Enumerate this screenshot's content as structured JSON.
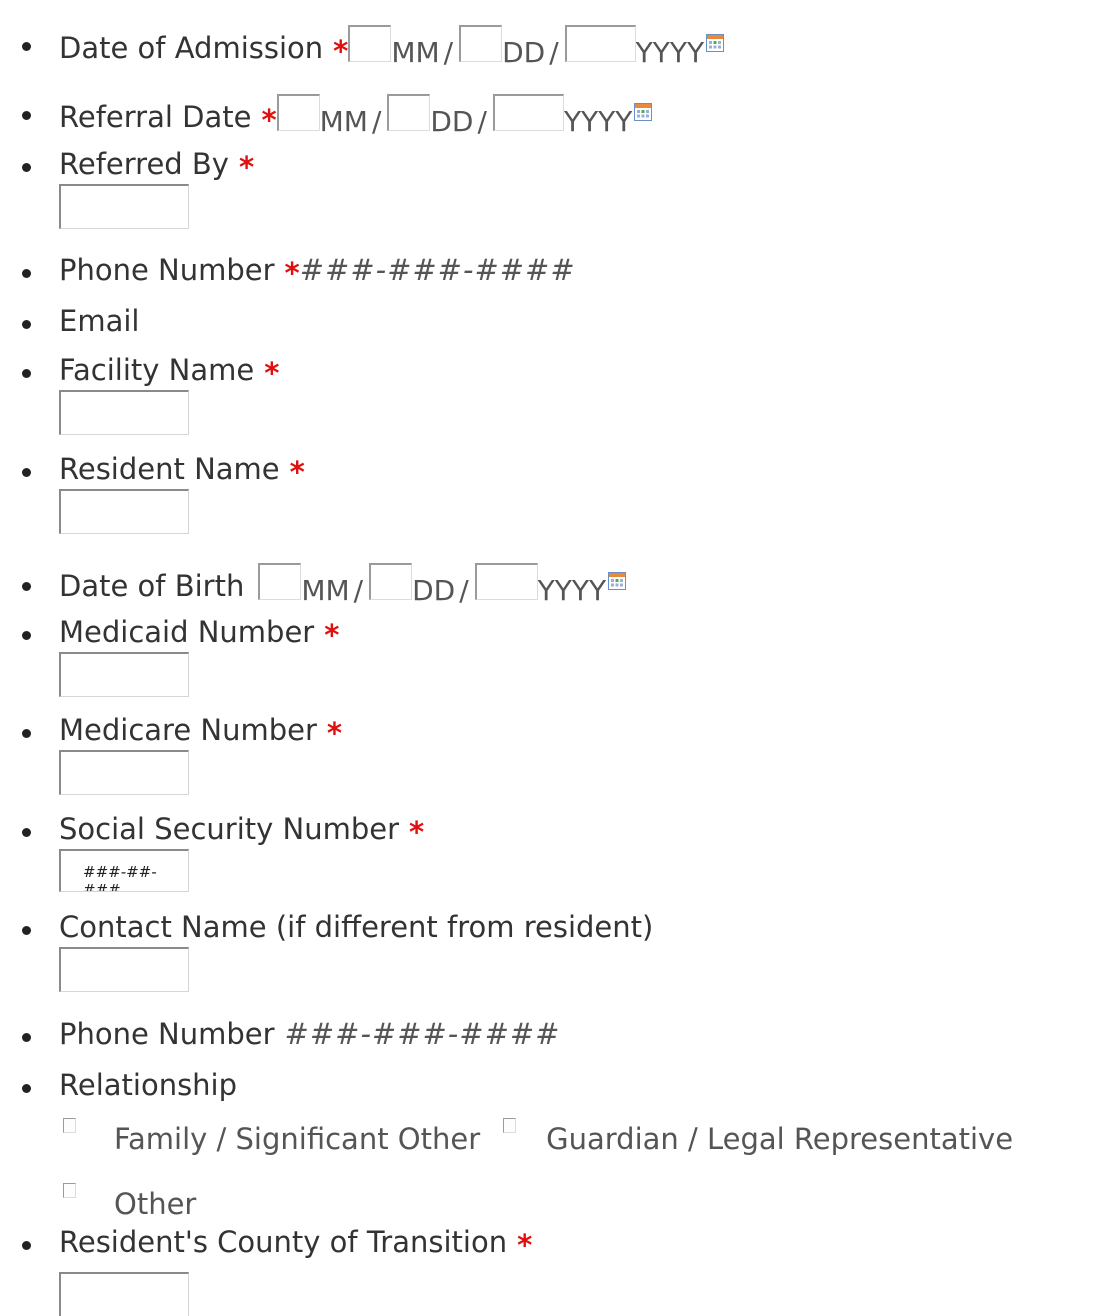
{
  "fields": {
    "date_of_admission": {
      "label": "Date of Admission",
      "required": "*",
      "mm": "MM",
      "dd": "DD",
      "yyyy": "YYYY",
      "sep": "/"
    },
    "referral_date": {
      "label": "Referral Date",
      "required": "*",
      "mm": "MM",
      "dd": "DD",
      "yyyy": "YYYY",
      "sep": "/"
    },
    "referred_by": {
      "label": "Referred By",
      "required": "*"
    },
    "phone_number": {
      "label": "Phone Number",
      "required": "*",
      "hint": "###-###-####"
    },
    "email": {
      "label": "Email"
    },
    "facility_name": {
      "label": "Facility Name",
      "required": "*"
    },
    "resident_name": {
      "label": "Resident Name",
      "required": "*"
    },
    "date_of_birth": {
      "label": "Date of Birth",
      "mm": "MM",
      "dd": "DD",
      "yyyy": "YYYY",
      "sep": "/"
    },
    "medicaid_number": {
      "label": "Medicaid Number",
      "required": "*"
    },
    "medicare_number": {
      "label": "Medicare Number",
      "required": "*"
    },
    "ssn": {
      "label": "Social Security Number",
      "required": "*",
      "placeholder": "###-##-###"
    },
    "contact_name": {
      "label": "Contact Name (if different from resident)"
    },
    "contact_phone": {
      "label": "Phone Number",
      "hint": "###-###-####"
    },
    "relationship": {
      "label": "Relationship",
      "options": [
        "Family / Significant Other",
        "Guardian / Legal Representative",
        "Other"
      ]
    },
    "county_of_transition": {
      "label": "Resident's County of Transition",
      "required": "*"
    }
  },
  "colors": {
    "text": "#333333",
    "required": "#e01010",
    "hint": "#555555",
    "input_border_dark": "#8a8a8a",
    "input_border_light": "#d6d6d6"
  },
  "icons": {
    "calendar": "calendar-icon",
    "bullet": "bullet-icon",
    "checkbox": "checkbox-icon"
  }
}
